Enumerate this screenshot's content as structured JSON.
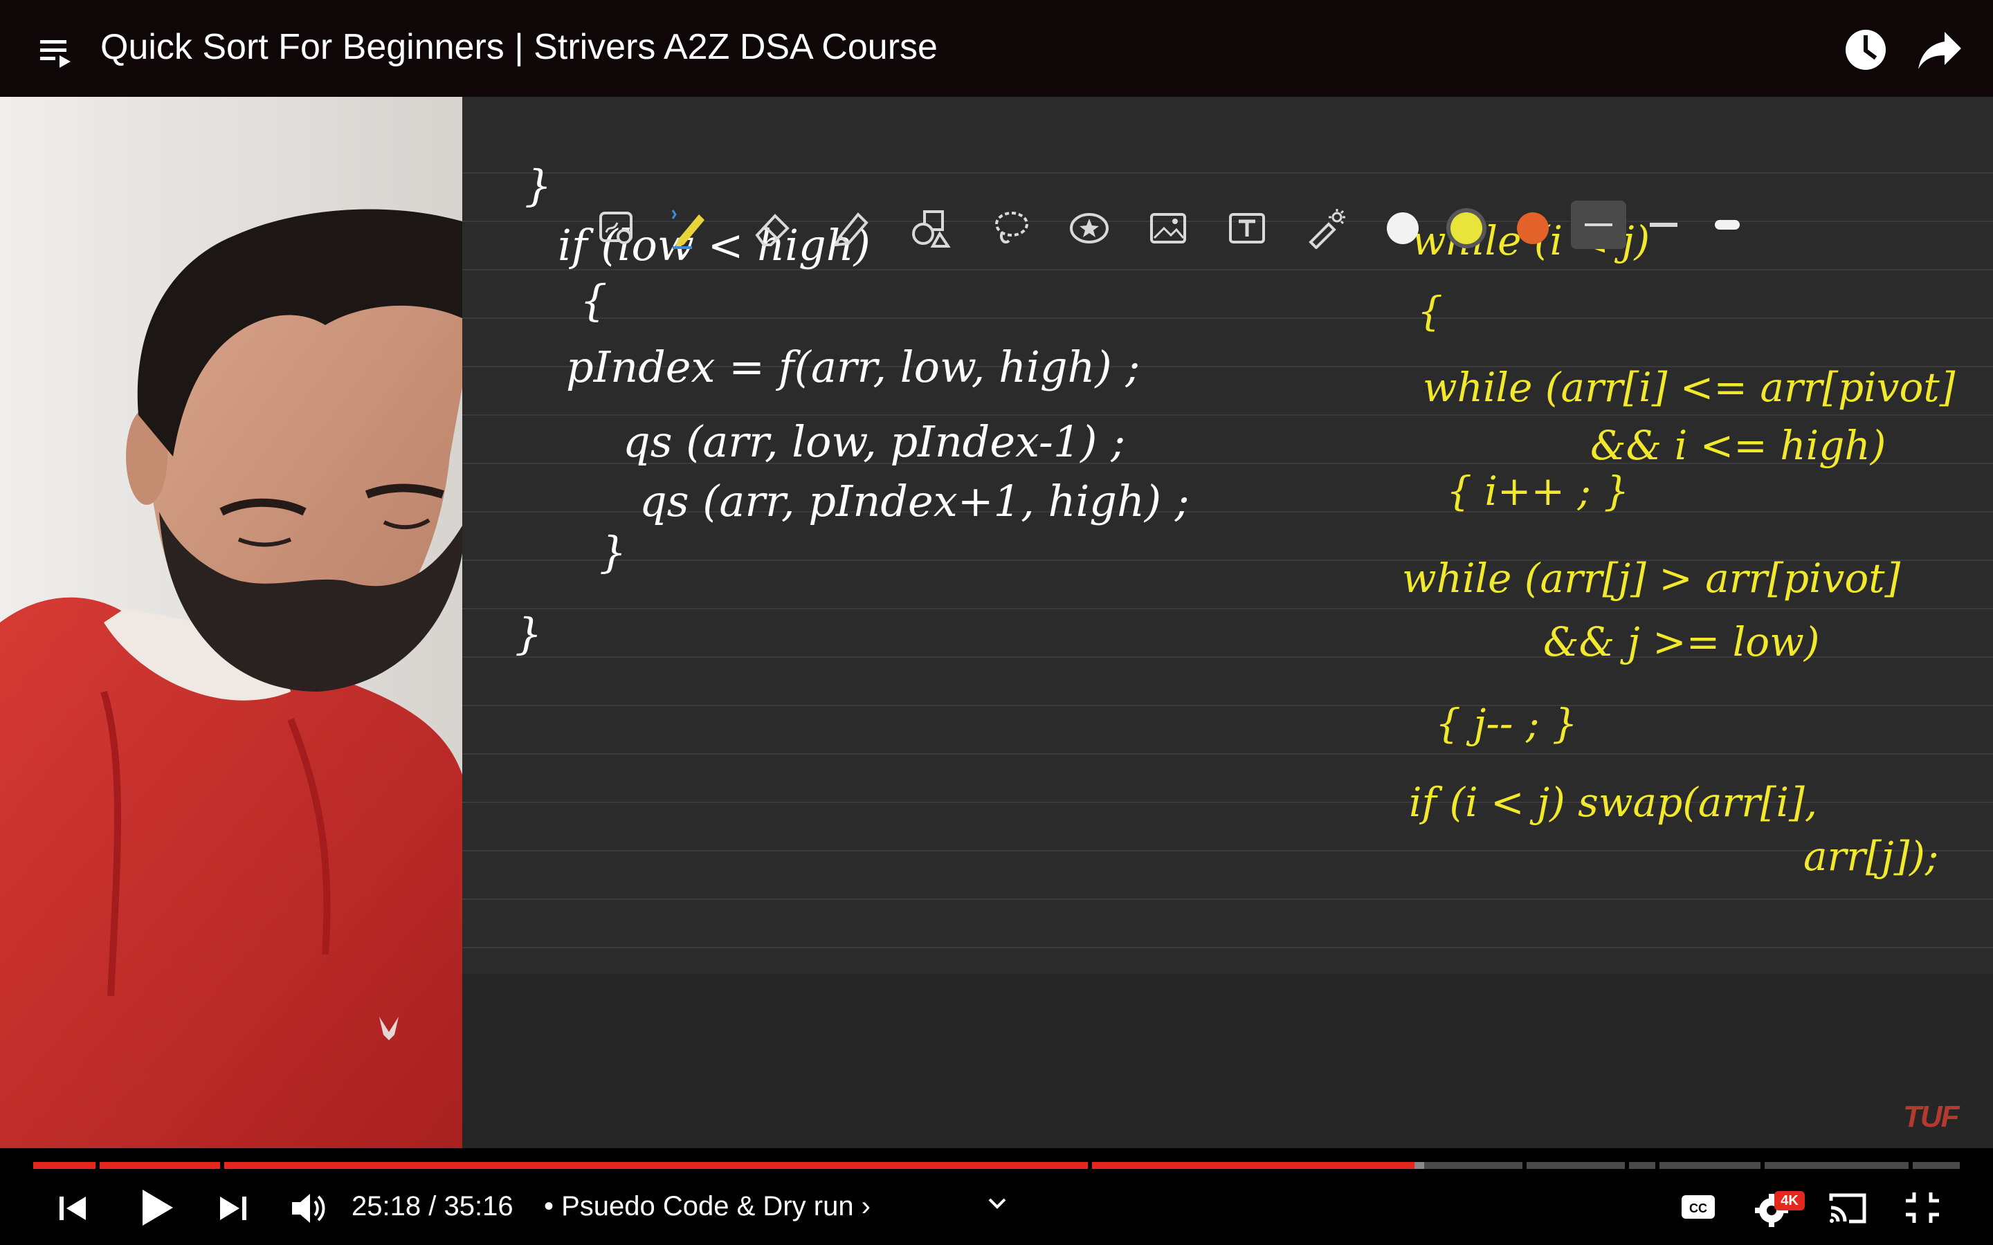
{
  "header": {
    "title": "Quick Sort For Beginners | Strivers A2Z DSA Course"
  },
  "player": {
    "time_current": "25:18",
    "time_separator": "/",
    "time_total": "35:16",
    "chapter": "• Psuedo Code & Dry run ›",
    "quality_badge": "4K",
    "progress_fraction": 0.717,
    "buffered_fraction": 0.722
  },
  "notes_app": {
    "tools": [
      "lasso-ai-icon",
      "pen-icon",
      "eraser-icon",
      "highlighter-icon",
      "shapes-icon",
      "lasso-icon",
      "sticker-icon",
      "image-icon",
      "text-icon",
      "laser-pointer-icon"
    ],
    "colors": [
      "#f2f2f2",
      "#e9e43a",
      "#e2622a"
    ],
    "watermark": "TUF",
    "left_code": [
      "}",
      "if (low < high)",
      "{",
      "pIndex = f(arr, low, high) ;",
      "qs (arr, low, pIndex-1) ;",
      "qs (arr, pIndex+1, high) ;",
      "}",
      "}"
    ],
    "right_code": [
      "while (i < j)",
      "{",
      "while (arr[i] <= arr[pivot]",
      "&& i <= high)",
      "{ i++ ; }",
      "while (arr[j] > arr[pivot]",
      "&& j >= low)",
      "{ j-- ; }",
      "if (i < j) swap(arr[i],",
      "arr[j]);"
    ]
  },
  "colors": {
    "progress_played": "#e5281d",
    "progress_buffered": "#8a8a8a",
    "progress_track": "#4a4a4a",
    "ink_white": "#ffffff",
    "ink_yellow": "#f2e82c"
  }
}
